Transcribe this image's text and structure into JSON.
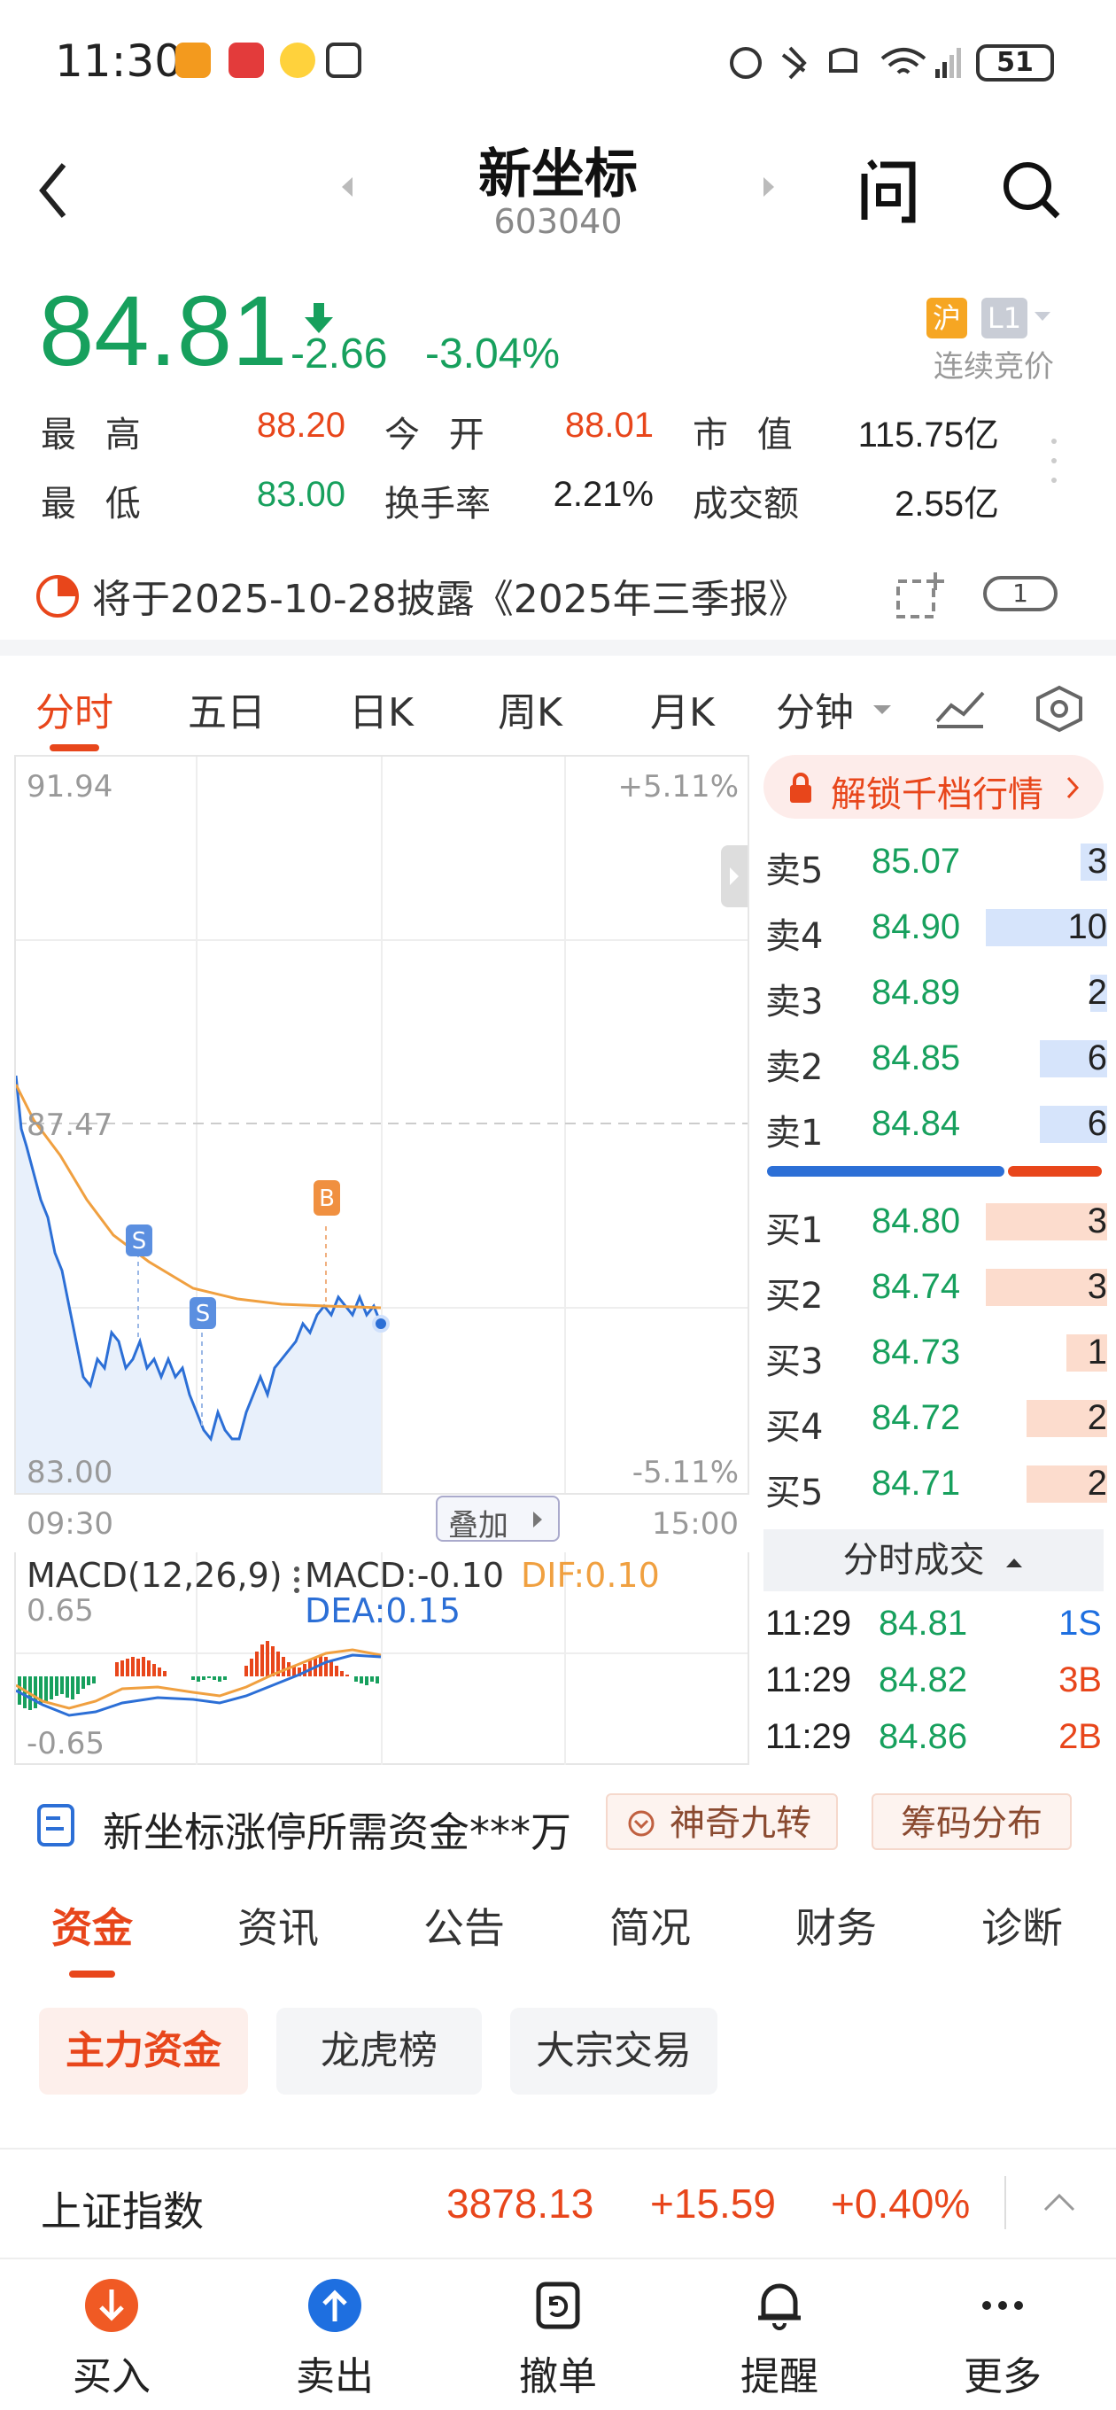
{
  "status_bar": {
    "time": "11:30",
    "battery": "51"
  },
  "header": {
    "stock_name": "新坐标",
    "stock_code": "603040"
  },
  "quote": {
    "price": "84.81",
    "change": "-2.66",
    "change_pct": "-3.04%",
    "market_badge": "沪",
    "level_badge": "L1",
    "session": "连续竞价",
    "stats": {
      "high_label": "最 高",
      "high": "88.20",
      "open_label": "今 开",
      "open": "88.01",
      "mcap_label": "市 值",
      "mcap": "115.75亿",
      "low_label": "最 低",
      "low": "83.00",
      "turnover_label": "换手率",
      "turnover": "2.21%",
      "amount_label": "成交额",
      "amount": "2.55亿"
    }
  },
  "notice": {
    "text": "将于2025-10-28披露《2025年三季报》",
    "badge": "1"
  },
  "chart_tabs": [
    "分时",
    "五日",
    "日K",
    "周K",
    "月K",
    "分钟"
  ],
  "chart": {
    "y_top": "91.94",
    "y_mid": "87.47",
    "y_bottom": "83.00",
    "pct_top": "+5.11%",
    "pct_bottom": "-5.11%",
    "x_start": "09:30",
    "x_end": "15:00",
    "overlay_button": "叠加",
    "marker_b": "B",
    "marker_s": "S",
    "macd_title": "MACD(12,26,9)",
    "macd_value": "MACD:-0.10",
    "dif": "DIF:0.10",
    "dea": "DEA:0.15",
    "macd_top": "0.65",
    "macd_bottom": "-0.65"
  },
  "orderbook": {
    "unlock_label": "解锁千档行情",
    "asks": [
      {
        "label": "卖5",
        "price": "85.07",
        "vol": "3",
        "fill": 0.08
      },
      {
        "label": "卖4",
        "price": "84.90",
        "vol": "10",
        "fill": 0.36
      },
      {
        "label": "卖3",
        "price": "84.89",
        "vol": "2",
        "fill": 0.05
      },
      {
        "label": "卖2",
        "price": "84.85",
        "vol": "6",
        "fill": 0.2
      },
      {
        "label": "卖1",
        "price": "84.84",
        "vol": "6",
        "fill": 0.2
      }
    ],
    "bids": [
      {
        "label": "买1",
        "price": "84.80",
        "vol": "3",
        "fill": 0.36
      },
      {
        "label": "买2",
        "price": "84.74",
        "vol": "3",
        "fill": 0.36
      },
      {
        "label": "买3",
        "price": "84.73",
        "vol": "1",
        "fill": 0.12
      },
      {
        "label": "买4",
        "price": "84.72",
        "vol": "2",
        "fill": 0.24
      },
      {
        "label": "买5",
        "price": "84.71",
        "vol": "2",
        "fill": 0.24
      }
    ],
    "ratio_sell": 0.71,
    "ticks_label": "分时成交",
    "ticks": [
      {
        "time": "11:29",
        "price": "84.81",
        "vol": "1S"
      },
      {
        "time": "11:29",
        "price": "84.82",
        "vol": "3B"
      },
      {
        "time": "11:29",
        "price": "84.86",
        "vol": "2B"
      }
    ]
  },
  "promo": {
    "text": "新坐标涨停所需资金***万",
    "pill1": "神奇九转",
    "pill2": "筹码分布"
  },
  "section_tabs": [
    "资金",
    "资讯",
    "公告",
    "简况",
    "财务",
    "诊断"
  ],
  "sub_tabs": [
    "主力资金",
    "龙虎榜",
    "大宗交易"
  ],
  "index_bar": {
    "name": "上证指数",
    "value": "3878.13",
    "change": "+15.59",
    "pct": "+0.40%"
  },
  "bottom_nav": [
    {
      "label": "买入"
    },
    {
      "label": "卖出"
    },
    {
      "label": "撤单"
    },
    {
      "label": "提醒"
    },
    {
      "label": "更多"
    }
  ],
  "colors": {
    "up": "#e8461b",
    "down": "#17a05d",
    "accent": "#e8461b",
    "line": "#2c6fd6",
    "avg": "#f0a040"
  }
}
